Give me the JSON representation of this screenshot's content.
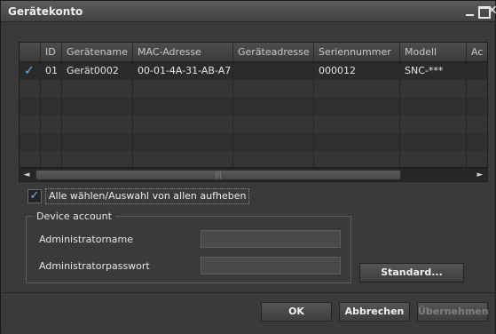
{
  "window": {
    "title": "Gerätekonto"
  },
  "grid": {
    "columns": [
      "",
      "ID",
      "Gerätename",
      "MAC-Adresse",
      "Geräteadresse",
      "Seriennummer",
      "Modell",
      "Ac"
    ],
    "rows": [
      {
        "checked": "✓",
        "id": "01",
        "name": "Gerät0002",
        "mac": "00-01-4A-31-AB-A7",
        "address": "",
        "serial": "000012",
        "model": "SNC-***",
        "extra": ""
      }
    ],
    "scroll_grip": "|||"
  },
  "select_all": {
    "checked": "✓",
    "label": "Alle wählen/Auswahl von allen aufheben"
  },
  "device_account": {
    "legend": "Device account",
    "admin_name_label": "Administratorname",
    "admin_name_value": "",
    "admin_password_label": "Administratorpasswort",
    "admin_password_value": ""
  },
  "buttons": {
    "standard": "Standard...",
    "ok": "OK",
    "cancel": "Abbrechen",
    "apply": "Übernehmen"
  },
  "icons": {
    "minimize": "minimize-icon",
    "maximize": "maximize-icon",
    "close": "close-icon",
    "scroll_left": "◄",
    "scroll_right": "►",
    "close_glyph": "✕"
  }
}
